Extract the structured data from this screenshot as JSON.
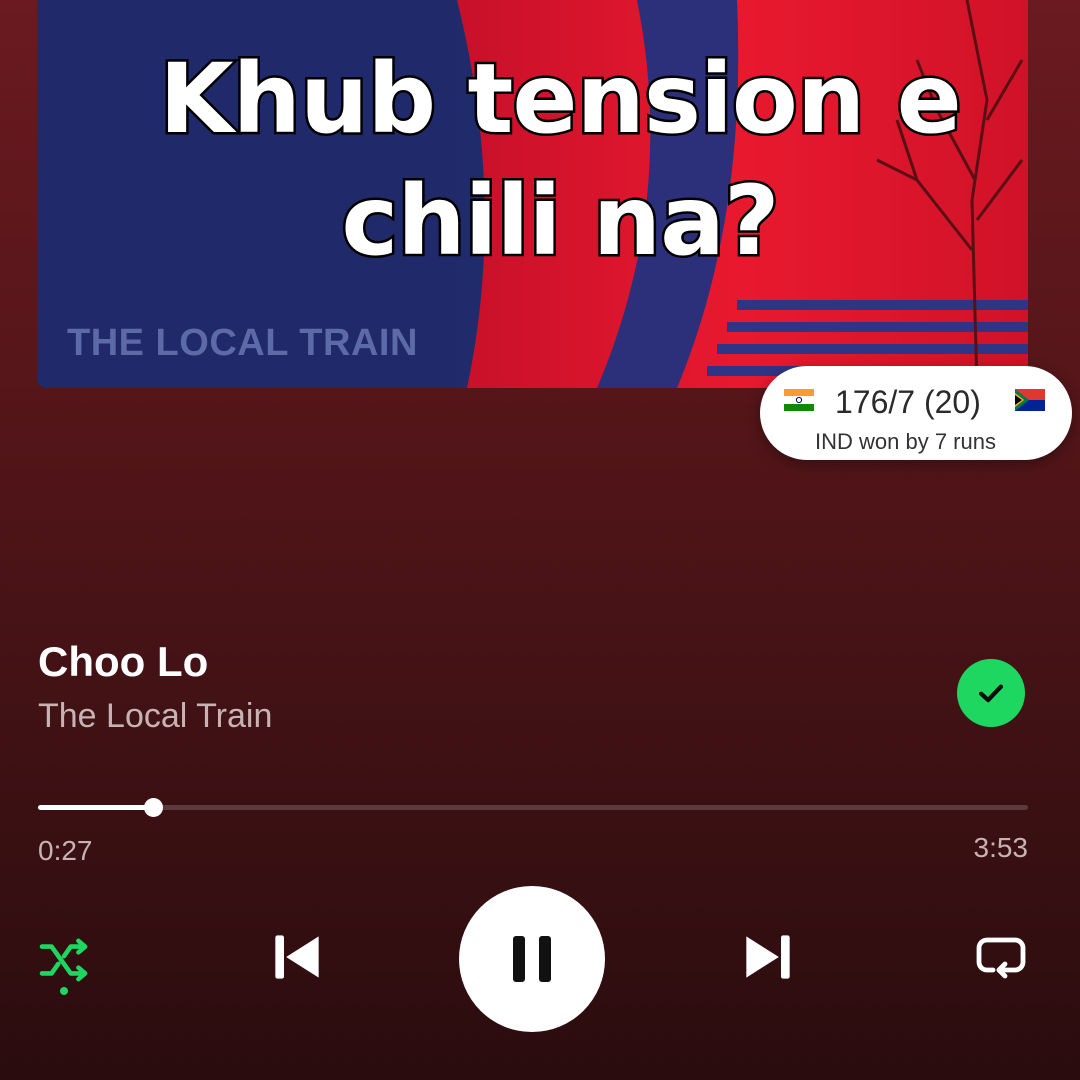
{
  "album": {
    "artist_text": "THE LOCAL TRAIN"
  },
  "caption": {
    "line1": "Khub tension e",
    "line2": "chili na?"
  },
  "score_widget": {
    "score": "176/7 (20)",
    "result": "IND won by 7 runs",
    "team1_flag": "india-flag-icon",
    "team2_flag": "south-africa-flag-icon"
  },
  "track": {
    "title": "Choo Lo",
    "artist": "The Local Train",
    "liked": true
  },
  "playback": {
    "elapsed": "0:27",
    "total": "3:53",
    "progress_fraction": 0.116,
    "state": "playing",
    "shuffle": true,
    "repeat": false
  },
  "icons": {
    "shuffle": "shuffle-icon",
    "previous": "skip-previous-icon",
    "pause": "pause-icon",
    "next": "skip-next-icon",
    "repeat": "repeat-icon",
    "liked": "check-icon"
  },
  "colors": {
    "accent": "#1ed760",
    "background_top": "#6a1a20",
    "background_bottom": "#2a0c0e",
    "secondary_text": "#c7b3b4"
  }
}
